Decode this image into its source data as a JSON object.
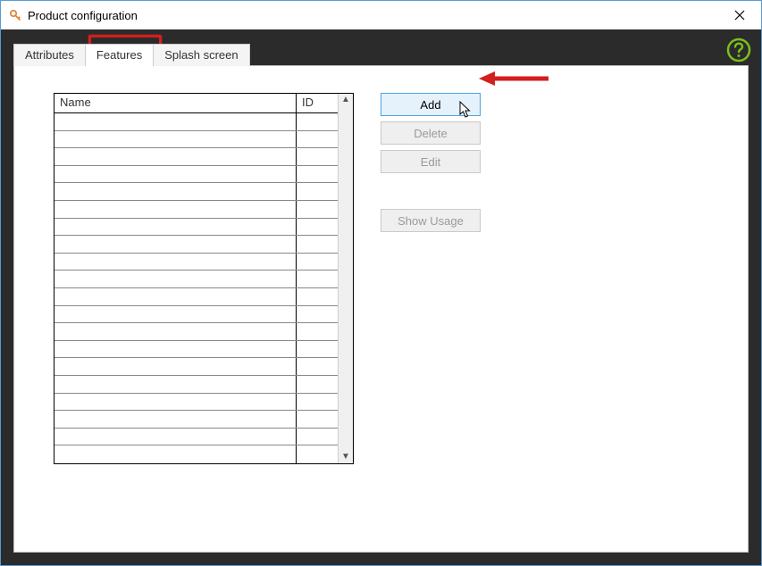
{
  "window": {
    "title": "Product configuration"
  },
  "tabs": {
    "attributes": "Attributes",
    "features": "Features",
    "splash": "Splash screen",
    "active": "features"
  },
  "table": {
    "col_name": "Name",
    "col_id": "ID",
    "row_count": 20
  },
  "buttons": {
    "add": "Add",
    "delete": "Delete",
    "edit": "Edit",
    "show_usage": "Show Usage"
  },
  "colors": {
    "highlight": "#d21f1f",
    "primary_border": "#4aa3df",
    "help_green": "#7bbf1e"
  }
}
